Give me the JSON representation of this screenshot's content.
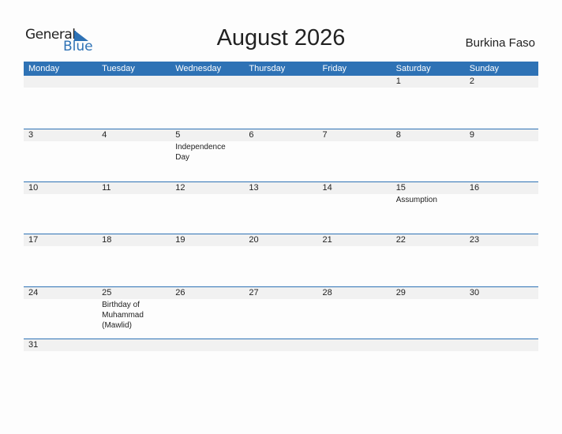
{
  "logo": {
    "general": "General",
    "blue": "Blue"
  },
  "title": "August 2026",
  "country": "Burkina Faso",
  "colors": {
    "accent": "#2e72b5",
    "band": "#f1f1f1"
  },
  "weekdays": [
    "Monday",
    "Tuesday",
    "Wednesday",
    "Thursday",
    "Friday",
    "Saturday",
    "Sunday"
  ],
  "weeks": [
    [
      {
        "d": ""
      },
      {
        "d": ""
      },
      {
        "d": ""
      },
      {
        "d": ""
      },
      {
        "d": ""
      },
      {
        "d": "1"
      },
      {
        "d": "2"
      }
    ],
    [
      {
        "d": "3"
      },
      {
        "d": "4"
      },
      {
        "d": "5",
        "e": "Independence Day"
      },
      {
        "d": "6"
      },
      {
        "d": "7"
      },
      {
        "d": "8"
      },
      {
        "d": "9"
      }
    ],
    [
      {
        "d": "10"
      },
      {
        "d": "11"
      },
      {
        "d": "12"
      },
      {
        "d": "13"
      },
      {
        "d": "14"
      },
      {
        "d": "15",
        "e": "Assumption"
      },
      {
        "d": "16"
      }
    ],
    [
      {
        "d": "17"
      },
      {
        "d": "18"
      },
      {
        "d": "19"
      },
      {
        "d": "20"
      },
      {
        "d": "21"
      },
      {
        "d": "22"
      },
      {
        "d": "23"
      }
    ],
    [
      {
        "d": "24"
      },
      {
        "d": "25",
        "e": "Birthday of Muhammad (Mawlid)"
      },
      {
        "d": "26"
      },
      {
        "d": "27"
      },
      {
        "d": "28"
      },
      {
        "d": "29"
      },
      {
        "d": "30"
      }
    ],
    [
      {
        "d": "31"
      },
      {
        "d": ""
      },
      {
        "d": ""
      },
      {
        "d": ""
      },
      {
        "d": ""
      },
      {
        "d": ""
      },
      {
        "d": ""
      }
    ]
  ]
}
